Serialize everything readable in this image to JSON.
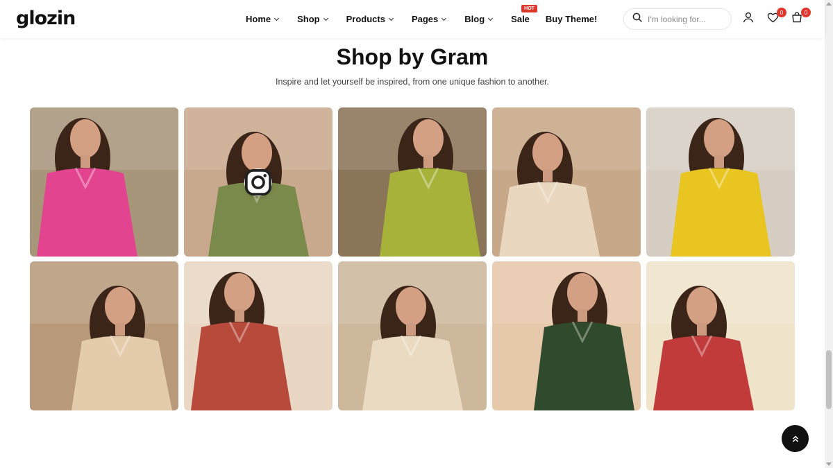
{
  "header": {
    "logo": "glozin",
    "nav": [
      {
        "label": "Home",
        "dropdown": true
      },
      {
        "label": "Shop",
        "dropdown": true
      },
      {
        "label": "Products",
        "dropdown": true
      },
      {
        "label": "Pages",
        "dropdown": true
      },
      {
        "label": "Blog",
        "dropdown": true
      },
      {
        "label": "Sale",
        "dropdown": false,
        "badge": "HOT"
      },
      {
        "label": "Buy Theme!",
        "dropdown": false
      }
    ],
    "search_placeholder": "I'm looking for...",
    "wishlist_count": "0",
    "cart_count": "0"
  },
  "section": {
    "title": "Shop by Gram",
    "subtitle": "Inspire and let yourself be inspired, from one unique fashion to another."
  },
  "gallery": [
    {
      "outfit": "pink",
      "bg": "#a8967b",
      "dress": "#e2448f"
    },
    {
      "outfit": "mirror-work kurta",
      "bg": "#c9a98d",
      "dress": "#7a8a4a",
      "instagram_hover": true
    },
    {
      "outfit": "lime",
      "bg": "#8a7558",
      "dress": "#a6b23a"
    },
    {
      "outfit": "cream chikankari",
      "bg": "#c7a888",
      "dress": "#e9d7bf"
    },
    {
      "outfit": "yellow",
      "bg": "#d6cec3",
      "dress": "#e8c521"
    },
    {
      "outfit": "beige dupatta",
      "bg": "#b89a7a",
      "dress": "#e4cbab"
    },
    {
      "outfit": "red floral",
      "bg": "#e9d6c3",
      "dress": "#b84a3c"
    },
    {
      "outfit": "cream anarkali",
      "bg": "#cdb89c",
      "dress": "#eadac1"
    },
    {
      "outfit": "green printed",
      "bg": "#e6c8ab",
      "dress": "#2f4a2c"
    },
    {
      "outfit": "cream and red",
      "bg": "#efe3c9",
      "dress": "#c23b3b"
    }
  ],
  "colors": {
    "badge": "#e0372c",
    "text": "#111111",
    "scroll_top_bg": "#111111"
  }
}
